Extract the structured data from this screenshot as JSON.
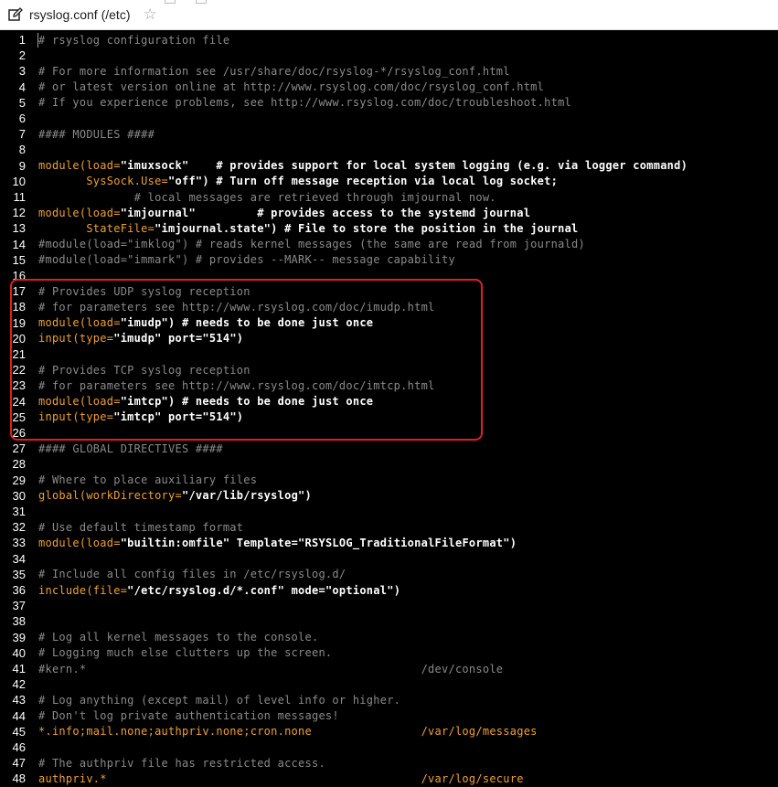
{
  "tab": {
    "title": "rsyslog.conf (/etc)",
    "icon": "edit-icon",
    "star_icon": "star-icon"
  },
  "colors": {
    "editor_bg": "#000000",
    "comment": "#8a8a8a",
    "keyword": "#f0a030",
    "string": "#ffffff",
    "highlight_border": "#e0201c"
  },
  "lines": [
    {
      "n": "1",
      "segs": [
        [
          "c",
          "# rsyslog configuration file"
        ]
      ]
    },
    {
      "n": "2",
      "segs": []
    },
    {
      "n": "3",
      "segs": [
        [
          "c",
          "# For more information see /usr/share/doc/rsyslog-*/rsyslog_conf.html"
        ]
      ]
    },
    {
      "n": "4",
      "segs": [
        [
          "c",
          "# or latest version online at http://www.rsyslog.com/doc/rsyslog_conf.html"
        ]
      ]
    },
    {
      "n": "5",
      "segs": [
        [
          "c",
          "# If you experience problems, see http://www.rsyslog.com/doc/troubleshoot.html"
        ]
      ]
    },
    {
      "n": "6",
      "segs": []
    },
    {
      "n": "7",
      "segs": [
        [
          "c",
          "#### MODULES ####"
        ]
      ]
    },
    {
      "n": "8",
      "segs": []
    },
    {
      "n": "9",
      "segs": [
        [
          "o",
          "module(load="
        ],
        [
          "w",
          "\"imuxsock\""
        ],
        [
          "w",
          "    # provides support for local system logging (e.g. via logger command)"
        ]
      ]
    },
    {
      "n": "10",
      "segs": [
        [
          "p",
          "       "
        ],
        [
          "o",
          "SysSock.Use="
        ],
        [
          "w",
          "\"off\""
        ],
        [
          "w",
          ") # Turn off message reception via local log socket;"
        ]
      ]
    },
    {
      "n": "11",
      "segs": [
        [
          "c",
          "              # local messages are retrieved through imjournal now."
        ]
      ]
    },
    {
      "n": "12",
      "segs": [
        [
          "o",
          "module(load="
        ],
        [
          "w",
          "\"imjournal\""
        ],
        [
          "w",
          "         # provides access to the systemd journal"
        ]
      ]
    },
    {
      "n": "13",
      "segs": [
        [
          "p",
          "       "
        ],
        [
          "o",
          "StateFile="
        ],
        [
          "w",
          "\"imjournal.state\""
        ],
        [
          "w",
          ") # File to store the position in the journal"
        ]
      ]
    },
    {
      "n": "14",
      "segs": [
        [
          "c",
          "#module(load=\"imklog\") # reads kernel messages (the same are read from journald)"
        ]
      ]
    },
    {
      "n": "15",
      "segs": [
        [
          "c",
          "#module(load=\"immark\") # provides --MARK-- message capability"
        ]
      ]
    },
    {
      "n": "16",
      "segs": []
    },
    {
      "n": "17",
      "segs": [
        [
          "c",
          "# Provides UDP syslog reception"
        ]
      ]
    },
    {
      "n": "18",
      "segs": [
        [
          "c",
          "# for parameters see http://www.rsyslog.com/doc/imudp.html"
        ]
      ]
    },
    {
      "n": "19",
      "segs": [
        [
          "o",
          "module(load="
        ],
        [
          "w",
          "\"imudp\""
        ],
        [
          "w",
          ") # needs to be done just once"
        ]
      ]
    },
    {
      "n": "20",
      "segs": [
        [
          "o",
          "input(type="
        ],
        [
          "w",
          "\"imudp\""
        ],
        [
          "w",
          " port="
        ],
        [
          "w",
          "\"514\""
        ],
        [
          "w",
          ")"
        ]
      ]
    },
    {
      "n": "21",
      "segs": []
    },
    {
      "n": "22",
      "segs": [
        [
          "c",
          "# Provides TCP syslog reception"
        ]
      ]
    },
    {
      "n": "23",
      "segs": [
        [
          "c",
          "# for parameters see http://www.rsyslog.com/doc/imtcp.html"
        ]
      ]
    },
    {
      "n": "24",
      "segs": [
        [
          "o",
          "module(load="
        ],
        [
          "w",
          "\"imtcp\""
        ],
        [
          "w",
          ") # needs to be done just once"
        ]
      ]
    },
    {
      "n": "25",
      "segs": [
        [
          "o",
          "input(type="
        ],
        [
          "w",
          "\"imtcp\""
        ],
        [
          "w",
          " port="
        ],
        [
          "w",
          "\"514\""
        ],
        [
          "w",
          ")"
        ]
      ]
    },
    {
      "n": "26",
      "segs": []
    },
    {
      "n": "27",
      "segs": [
        [
          "c",
          "#### GLOBAL DIRECTIVES ####"
        ]
      ]
    },
    {
      "n": "28",
      "segs": []
    },
    {
      "n": "29",
      "segs": [
        [
          "c",
          "# Where to place auxiliary files"
        ]
      ]
    },
    {
      "n": "30",
      "segs": [
        [
          "o",
          "global(workDirectory="
        ],
        [
          "w",
          "\"/var/lib/rsyslog\""
        ],
        [
          "w",
          ")"
        ]
      ]
    },
    {
      "n": "31",
      "segs": []
    },
    {
      "n": "32",
      "segs": [
        [
          "c",
          "# Use default timestamp format"
        ]
      ]
    },
    {
      "n": "33",
      "segs": [
        [
          "o",
          "module(load="
        ],
        [
          "w",
          "\"builtin:omfile\""
        ],
        [
          "w",
          " Template="
        ],
        [
          "w",
          "\"RSYSLOG_TraditionalFileFormat\""
        ],
        [
          "w",
          ")"
        ]
      ]
    },
    {
      "n": "34",
      "segs": []
    },
    {
      "n": "35",
      "segs": [
        [
          "c",
          "# Include all config files in /etc/rsyslog.d/"
        ]
      ]
    },
    {
      "n": "36",
      "segs": [
        [
          "o",
          "include(file="
        ],
        [
          "w",
          "\"/etc/rsyslog.d/*.conf\""
        ],
        [
          "w",
          " mode="
        ],
        [
          "w",
          "\"optional\""
        ],
        [
          "w",
          ")"
        ]
      ]
    },
    {
      "n": "37",
      "segs": []
    },
    {
      "n": "38",
      "segs": []
    },
    {
      "n": "39",
      "segs": [
        [
          "c",
          "# Log all kernel messages to the console."
        ]
      ]
    },
    {
      "n": "40",
      "segs": [
        [
          "c",
          "# Logging much else clutters up the screen."
        ]
      ]
    },
    {
      "n": "41",
      "segs": [
        [
          "c",
          "#kern.*                                                 /dev/console"
        ]
      ]
    },
    {
      "n": "42",
      "segs": []
    },
    {
      "n": "43",
      "segs": [
        [
          "c",
          "# Log anything (except mail) of level info or higher."
        ]
      ]
    },
    {
      "n": "44",
      "segs": [
        [
          "c",
          "# Don't log private authentication messages!"
        ]
      ]
    },
    {
      "n": "45",
      "segs": [
        [
          "o",
          "*.info;mail.none;authpriv.none;cron.none                /var/log/messages"
        ]
      ]
    },
    {
      "n": "46",
      "segs": []
    },
    {
      "n": "47",
      "segs": [
        [
          "c",
          "# The authpriv file has restricted access."
        ]
      ]
    },
    {
      "n": "48",
      "segs": [
        [
          "o",
          "authpriv.*                                              /var/log/secure"
        ]
      ]
    }
  ]
}
